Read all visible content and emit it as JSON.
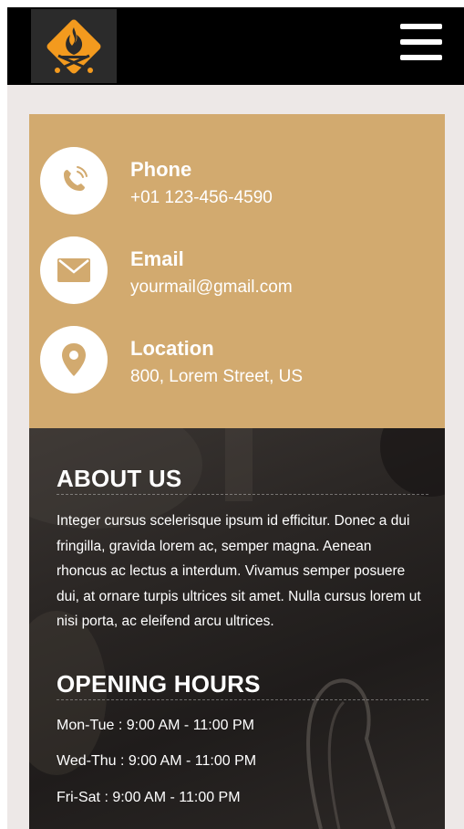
{
  "header": {
    "logo_icon": "grill-flame-logo-icon",
    "menu_icon": "hamburger-menu-icon"
  },
  "colors": {
    "header_bg": "#000000",
    "logo_orange": "#f39a1e",
    "contact_bg": "#d2aa6f",
    "page_bg": "#ede8e7",
    "info_bg": "#2a2624"
  },
  "contact": {
    "phone": {
      "icon": "phone-icon",
      "title": "Phone",
      "value": "+01 123-456-4590"
    },
    "email": {
      "icon": "envelope-icon",
      "title": "Email",
      "value": "yourmail@gmail.com"
    },
    "location": {
      "icon": "map-pin-icon",
      "title": "Location",
      "value": "800, Lorem Street, US"
    }
  },
  "about": {
    "title": "ABOUT US",
    "text": "Integer cursus scelerisque ipsum id efficitur. Donec a dui fringilla, gravida lorem ac, semper magna. Aenean rhoncus ac lectus a interdum. Vivamus semper posuere dui, at ornare turpis ultrices sit amet. Nulla cursus lorem ut nisi porta, ac eleifend arcu ultrices."
  },
  "hours": {
    "title": "OPENING HOURS",
    "items": [
      "Mon-Tue : 9:00 AM - 11:00 PM",
      "Wed-Thu : 9:00 AM - 11:00 PM",
      "Fri-Sat : 9:00 AM - 11:00 PM"
    ]
  }
}
